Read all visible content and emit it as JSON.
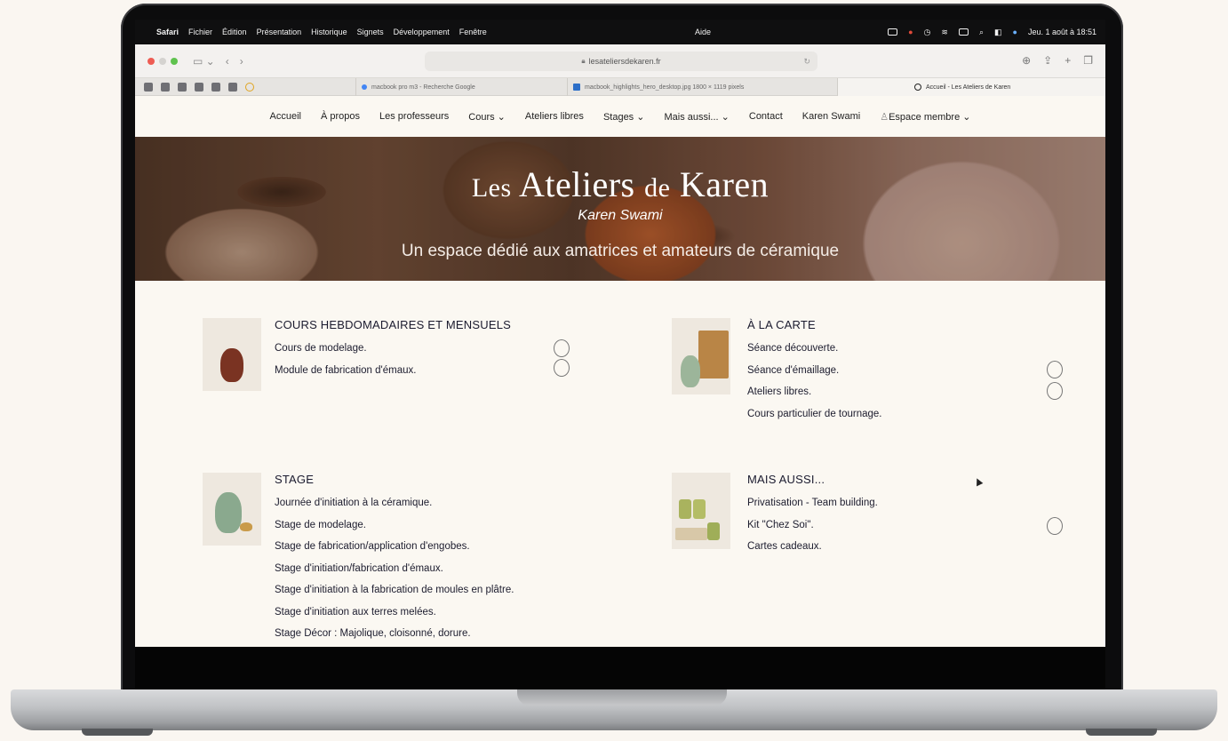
{
  "menubar": {
    "apple": "",
    "items": [
      "Safari",
      "Fichier",
      "Édition",
      "Présentation",
      "Historique",
      "Signets",
      "Développement",
      "Fenêtre"
    ],
    "aide": "Aide",
    "datetime": "Jeu. 1 août à 18:51"
  },
  "browser": {
    "url": "lesateliersdekaren.fr",
    "tabs": [
      "macbook pro m3 - Recherche Google",
      "macbook_highlights_hero_desktop.jpg 1800 × 1119 pixels",
      "Accueil - Les Ateliers de Karen"
    ]
  },
  "nav": {
    "items": [
      {
        "label": "Accueil"
      },
      {
        "label": "À propos"
      },
      {
        "label": "Les professeurs"
      },
      {
        "label": "Cours ⌄"
      },
      {
        "label": "Ateliers libres"
      },
      {
        "label": "Stages ⌄"
      },
      {
        "label": "Mais aussi... ⌄"
      },
      {
        "label": "Contact"
      },
      {
        "label": "Karen Swami"
      },
      {
        "label": "Espace membre ⌄"
      }
    ]
  },
  "hero": {
    "title_les": "Les",
    "title_ateliers": "Ateliers",
    "title_de": "de",
    "title_karen": "Karen",
    "author": "Karen Swami",
    "tagline": "Un espace dédié aux amatrices et amateurs de céramique"
  },
  "sections": {
    "cours": {
      "title": "COURS HEBDOMADAIRES ET MENSUELS",
      "items": [
        "Cours de modelage.",
        "Module de fabrication d'émaux."
      ]
    },
    "carte": {
      "title": "À LA CARTE",
      "items": [
        "Séance découverte.",
        "Séance d'émaillage.",
        "Ateliers libres.",
        "Cours particulier de tournage."
      ]
    },
    "stage": {
      "title": "STAGE",
      "items": [
        "Journée d'initiation à la céramique.",
        "Stage de modelage.",
        "Stage de fabrication/application d'engobes.",
        "Stage d'initiation/fabrication d'émaux.",
        "Stage d'initiation à la fabrication de moules en plâtre.",
        "Stage d'initiation aux terres melées.",
        "Stage Décor : Majolique, cloisonné, dorure."
      ]
    },
    "aussi": {
      "title": "MAIS AUSSI...",
      "items": [
        "Privatisation - Team building.",
        "Kit \"Chez Soi\".",
        "Cartes cadeaux."
      ]
    }
  }
}
